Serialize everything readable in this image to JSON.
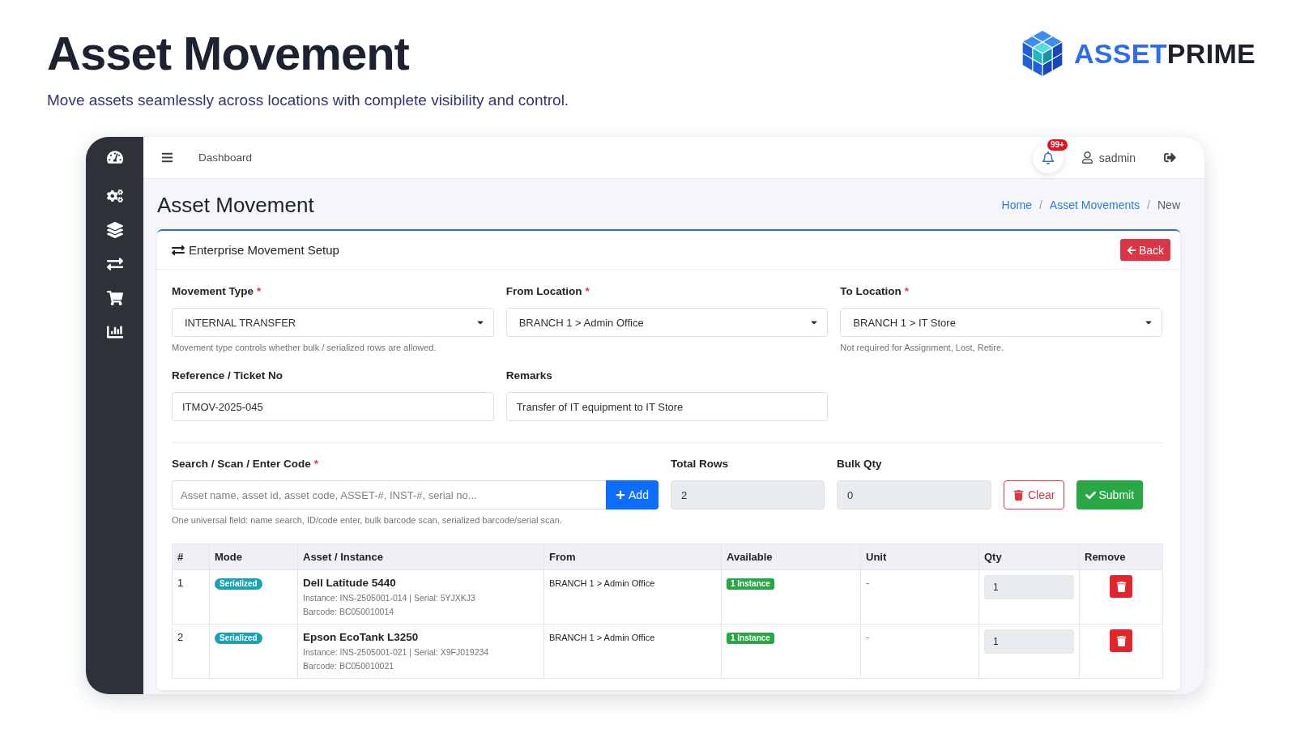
{
  "header": {
    "title": "Asset Movement",
    "subtitle": "Move assets seamlessly across locations with complete visibility and control."
  },
  "logo": {
    "accent": "ASSET",
    "rest": "PRIME"
  },
  "topbar": {
    "link": "Dashboard",
    "notification_count": "99+",
    "user": "sadmin"
  },
  "page": {
    "title": "Asset Movement",
    "breadcrumb": [
      {
        "label": "Home",
        "kind": "link"
      },
      {
        "label": "/",
        "kind": "separator"
      },
      {
        "label": "Asset Movements",
        "kind": "link"
      },
      {
        "label": "/",
        "kind": "separator"
      },
      {
        "label": "New",
        "kind": "current"
      }
    ]
  },
  "card": {
    "title": "Enterprise Movement Setup",
    "back_button": "Back"
  },
  "form": {
    "fields": [
      {
        "kind": "select",
        "label": "Movement Type",
        "required_mark": "*",
        "value": "INTERNAL TRANSFER",
        "help": "Movement type controls whether bulk / serialized rows are allowed."
      },
      {
        "kind": "select",
        "label": "From Location",
        "required_mark": "*",
        "value": "BRANCH 1 > Admin Office"
      },
      {
        "kind": "select",
        "label": "To Location",
        "required_mark": "*",
        "value": "BRANCH 1 > IT Store",
        "help": "Not required for Assignment, Lost, Retire."
      },
      {
        "kind": "text",
        "label": "Reference / Ticket No",
        "value": "ITMOV-2025-045"
      },
      {
        "kind": "text",
        "label": "Remarks",
        "value": "Transfer of IT equipment to IT Store"
      }
    ]
  },
  "scan": {
    "label": "Search / Scan / Enter Code",
    "required_mark": "*",
    "placeholder": "Asset name, asset id, asset code, ASSET-#, INST-#, serial no...",
    "add_button": "Add",
    "help": "One universal field: name search, ID/code enter, bulk barcode scan, serialized barcode/serial scan.",
    "counters": [
      {
        "label": "Total Rows",
        "value": "2",
        "readonly": true
      },
      {
        "label": "Bulk Qty",
        "value": "0",
        "readonly": true
      }
    ],
    "clear_button": "Clear",
    "submit_button": "Submit"
  },
  "table": {
    "columns": [
      "#",
      "Mode",
      "Asset / Instance",
      "From",
      "Available",
      "Unit",
      "Qty",
      "Remove"
    ],
    "rows": [
      {
        "number": "1",
        "mode": "Serialized",
        "asset": "Dell Latitude 5440",
        "instance": "Instance: INS-2505001-014 | Serial: 5YJXKJ3",
        "barcode": "Barcode: BC050010014",
        "from": "BRANCH 1 > Admin Office",
        "available": "1 Instance",
        "unit": "-",
        "qty": "1",
        "qty_readonly": true
      },
      {
        "number": "2",
        "mode": "Serialized",
        "asset": "Epson EcoTank L3250",
        "instance": "Instance: INS-2505001-021 | Serial: X9FJ019234",
        "barcode": "Barcode: BC050010021",
        "from": "BRANCH 1 > Admin Office",
        "available": "1 Instance",
        "unit": "-",
        "qty": "1",
        "qty_readonly": true
      }
    ]
  }
}
